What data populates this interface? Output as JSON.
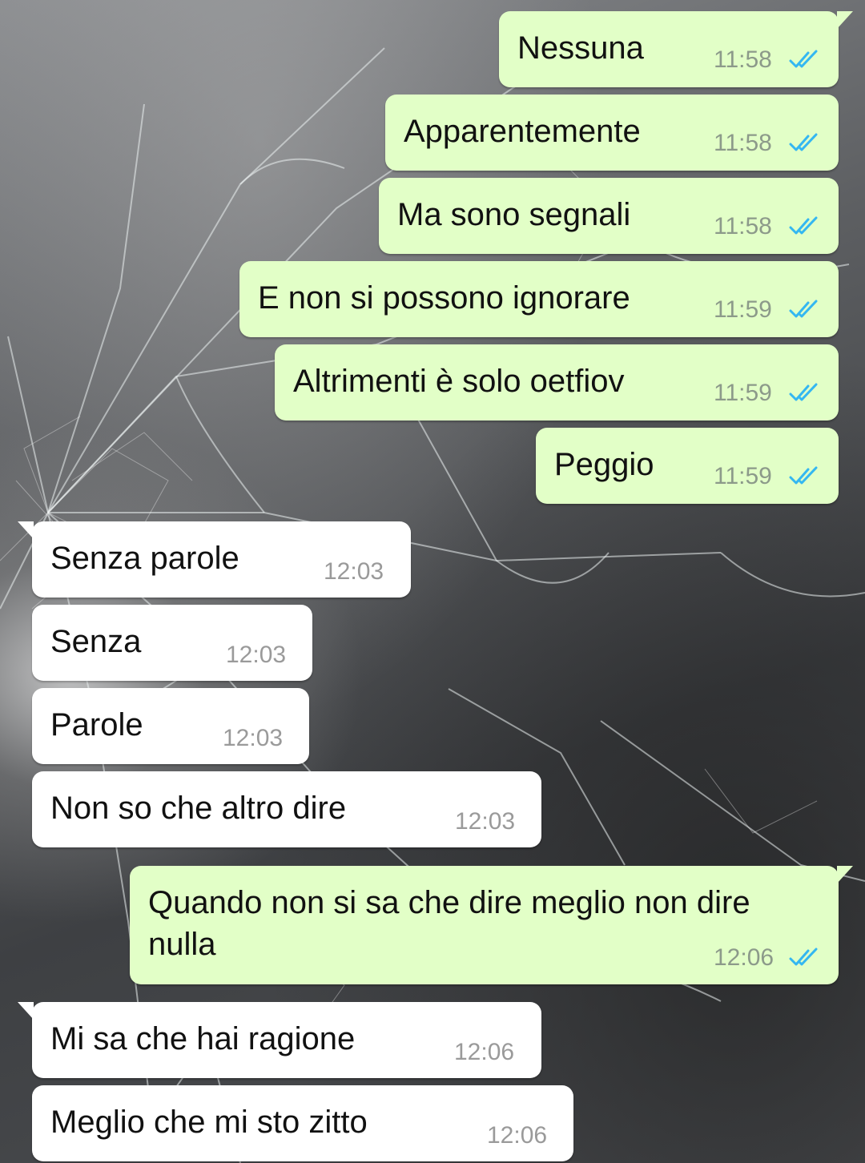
{
  "chat": {
    "messages": [
      {
        "direction": "outgoing",
        "text": "Nessuna",
        "time": "11:58",
        "status": "read-double-check"
      },
      {
        "direction": "outgoing",
        "text": "Apparentemente",
        "time": "11:58",
        "status": "read-double-check"
      },
      {
        "direction": "outgoing",
        "text": "Ma sono segnali",
        "time": "11:58",
        "status": "read-double-check"
      },
      {
        "direction": "outgoing",
        "text": "E non si possono ignorare",
        "time": "11:59",
        "status": "read-double-check"
      },
      {
        "direction": "outgoing",
        "text": "Altrimenti è solo oetfiov",
        "time": "11:59",
        "status": "read-double-check"
      },
      {
        "direction": "outgoing",
        "text": "Peggio",
        "time": "11:59",
        "status": "read-double-check"
      },
      {
        "direction": "incoming",
        "text": "Senza parole",
        "time": "12:03"
      },
      {
        "direction": "incoming",
        "text": "Senza",
        "time": "12:03"
      },
      {
        "direction": "incoming",
        "text": "Parole",
        "time": "12:03"
      },
      {
        "direction": "incoming",
        "text": "Non so che altro dire",
        "time": "12:03"
      },
      {
        "direction": "outgoing",
        "text_line1": "Quando non si sa che dire meglio non dire",
        "text_line2": "nulla",
        "time": "12:06",
        "status": "read-double-check"
      },
      {
        "direction": "incoming",
        "text": "Mi sa che hai ragione",
        "time": "12:06"
      },
      {
        "direction": "incoming",
        "text": "Meglio che mi sto zitto",
        "time": "12:06"
      }
    ]
  },
  "colors": {
    "outgoing_bubble": "#e2ffc7",
    "incoming_bubble": "#ffffff",
    "read_tick": "#34b7f1",
    "wallpaper": "#55575a"
  },
  "wallpaper": {
    "description_icon": "shattered-glass-wallpaper"
  }
}
